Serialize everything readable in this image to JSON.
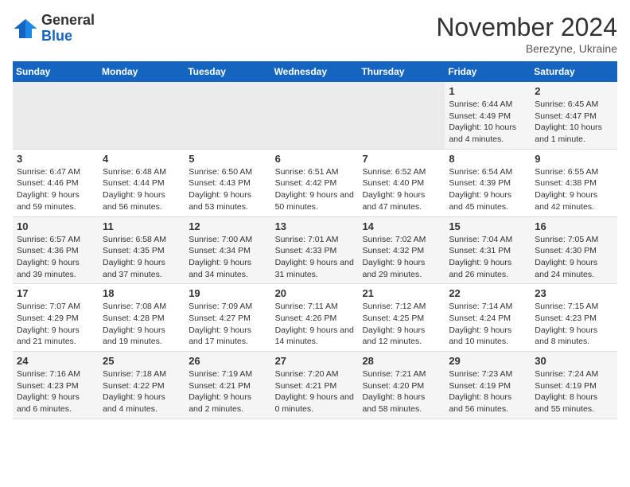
{
  "logo": {
    "general": "General",
    "blue": "Blue"
  },
  "title": {
    "month_year": "November 2024",
    "location": "Berezyne, Ukraine"
  },
  "days_of_week": [
    "Sunday",
    "Monday",
    "Tuesday",
    "Wednesday",
    "Thursday",
    "Friday",
    "Saturday"
  ],
  "weeks": [
    [
      {
        "day": "",
        "info": ""
      },
      {
        "day": "",
        "info": ""
      },
      {
        "day": "",
        "info": ""
      },
      {
        "day": "",
        "info": ""
      },
      {
        "day": "",
        "info": ""
      },
      {
        "day": "1",
        "info": "Sunrise: 6:44 AM\nSunset: 4:49 PM\nDaylight: 10 hours and 4 minutes."
      },
      {
        "day": "2",
        "info": "Sunrise: 6:45 AM\nSunset: 4:47 PM\nDaylight: 10 hours and 1 minute."
      }
    ],
    [
      {
        "day": "3",
        "info": "Sunrise: 6:47 AM\nSunset: 4:46 PM\nDaylight: 9 hours and 59 minutes."
      },
      {
        "day": "4",
        "info": "Sunrise: 6:48 AM\nSunset: 4:44 PM\nDaylight: 9 hours and 56 minutes."
      },
      {
        "day": "5",
        "info": "Sunrise: 6:50 AM\nSunset: 4:43 PM\nDaylight: 9 hours and 53 minutes."
      },
      {
        "day": "6",
        "info": "Sunrise: 6:51 AM\nSunset: 4:42 PM\nDaylight: 9 hours and 50 minutes."
      },
      {
        "day": "7",
        "info": "Sunrise: 6:52 AM\nSunset: 4:40 PM\nDaylight: 9 hours and 47 minutes."
      },
      {
        "day": "8",
        "info": "Sunrise: 6:54 AM\nSunset: 4:39 PM\nDaylight: 9 hours and 45 minutes."
      },
      {
        "day": "9",
        "info": "Sunrise: 6:55 AM\nSunset: 4:38 PM\nDaylight: 9 hours and 42 minutes."
      }
    ],
    [
      {
        "day": "10",
        "info": "Sunrise: 6:57 AM\nSunset: 4:36 PM\nDaylight: 9 hours and 39 minutes."
      },
      {
        "day": "11",
        "info": "Sunrise: 6:58 AM\nSunset: 4:35 PM\nDaylight: 9 hours and 37 minutes."
      },
      {
        "day": "12",
        "info": "Sunrise: 7:00 AM\nSunset: 4:34 PM\nDaylight: 9 hours and 34 minutes."
      },
      {
        "day": "13",
        "info": "Sunrise: 7:01 AM\nSunset: 4:33 PM\nDaylight: 9 hours and 31 minutes."
      },
      {
        "day": "14",
        "info": "Sunrise: 7:02 AM\nSunset: 4:32 PM\nDaylight: 9 hours and 29 minutes."
      },
      {
        "day": "15",
        "info": "Sunrise: 7:04 AM\nSunset: 4:31 PM\nDaylight: 9 hours and 26 minutes."
      },
      {
        "day": "16",
        "info": "Sunrise: 7:05 AM\nSunset: 4:30 PM\nDaylight: 9 hours and 24 minutes."
      }
    ],
    [
      {
        "day": "17",
        "info": "Sunrise: 7:07 AM\nSunset: 4:29 PM\nDaylight: 9 hours and 21 minutes."
      },
      {
        "day": "18",
        "info": "Sunrise: 7:08 AM\nSunset: 4:28 PM\nDaylight: 9 hours and 19 minutes."
      },
      {
        "day": "19",
        "info": "Sunrise: 7:09 AM\nSunset: 4:27 PM\nDaylight: 9 hours and 17 minutes."
      },
      {
        "day": "20",
        "info": "Sunrise: 7:11 AM\nSunset: 4:26 PM\nDaylight: 9 hours and 14 minutes."
      },
      {
        "day": "21",
        "info": "Sunrise: 7:12 AM\nSunset: 4:25 PM\nDaylight: 9 hours and 12 minutes."
      },
      {
        "day": "22",
        "info": "Sunrise: 7:14 AM\nSunset: 4:24 PM\nDaylight: 9 hours and 10 minutes."
      },
      {
        "day": "23",
        "info": "Sunrise: 7:15 AM\nSunset: 4:23 PM\nDaylight: 9 hours and 8 minutes."
      }
    ],
    [
      {
        "day": "24",
        "info": "Sunrise: 7:16 AM\nSunset: 4:23 PM\nDaylight: 9 hours and 6 minutes."
      },
      {
        "day": "25",
        "info": "Sunrise: 7:18 AM\nSunset: 4:22 PM\nDaylight: 9 hours and 4 minutes."
      },
      {
        "day": "26",
        "info": "Sunrise: 7:19 AM\nSunset: 4:21 PM\nDaylight: 9 hours and 2 minutes."
      },
      {
        "day": "27",
        "info": "Sunrise: 7:20 AM\nSunset: 4:21 PM\nDaylight: 9 hours and 0 minutes."
      },
      {
        "day": "28",
        "info": "Sunrise: 7:21 AM\nSunset: 4:20 PM\nDaylight: 8 hours and 58 minutes."
      },
      {
        "day": "29",
        "info": "Sunrise: 7:23 AM\nSunset: 4:19 PM\nDaylight: 8 hours and 56 minutes."
      },
      {
        "day": "30",
        "info": "Sunrise: 7:24 AM\nSunset: 4:19 PM\nDaylight: 8 hours and 55 minutes."
      }
    ]
  ]
}
